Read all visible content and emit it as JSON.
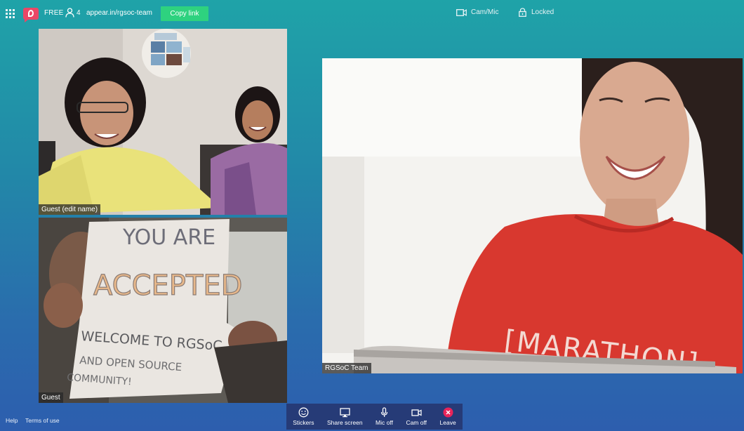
{
  "topbar": {
    "plan": "FREE",
    "user_count": "4",
    "room_url": "appear.in/rgsoc-team",
    "copy_label": "Copy link",
    "cam_mic_label": "Cam/Mic",
    "locked_label": "Locked"
  },
  "tiles": [
    {
      "label": "Guest (edit name)"
    },
    {
      "label": "Guest"
    },
    {
      "label": "RGSoC Team"
    }
  ],
  "sign_text": {
    "line1": "YOU ARE",
    "line2": "ACCEPTED",
    "line3": "WELCOME TO RGSoC",
    "line4": "AND OPEN SOURCE",
    "line5": "COMMUNITY!"
  },
  "shirt_text": "[MARATHON]",
  "toolbar": {
    "stickers": "Stickers",
    "share_screen": "Share screen",
    "mic_off": "Mic off",
    "cam_off": "Cam off",
    "leave": "Leave"
  },
  "footer": {
    "help": "Help",
    "terms": "Terms of use"
  },
  "colors": {
    "accent_green": "#2ed27f",
    "brand_pink": "#ea4766",
    "toolbar_bg": "#263b77"
  }
}
